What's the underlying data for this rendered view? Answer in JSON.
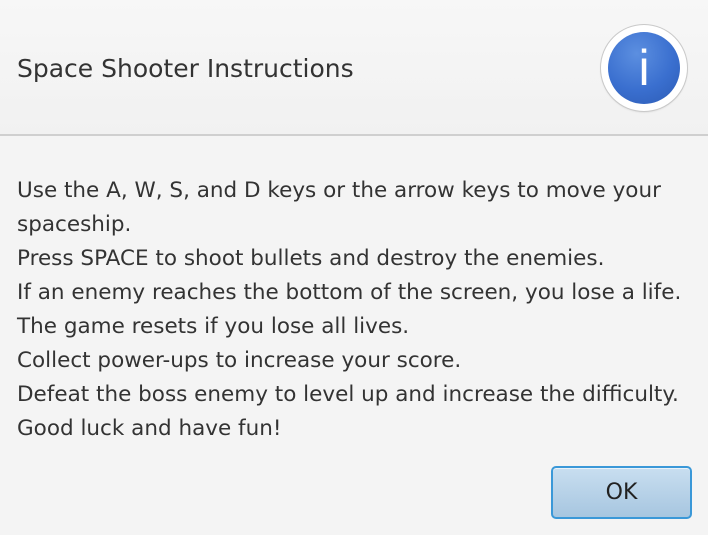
{
  "dialog": {
    "title": "Space Shooter Instructions",
    "icon": "info-icon",
    "icon_glyph": "i",
    "accent_color": "#3a6fcf",
    "lines": [
      "Use the A, W, S, and D keys or the arrow keys to move your",
      "spaceship.",
      "Press SPACE to shoot bullets and destroy the enemies.",
      "If an enemy reaches the bottom of the screen, you lose a life.",
      "The game resets if you lose all lives.",
      "Collect power-ups to increase your score.",
      "Defeat the boss enemy to level up and increase the difficulty.",
      "Good luck and have fun!"
    ],
    "ok_label": "OK"
  }
}
